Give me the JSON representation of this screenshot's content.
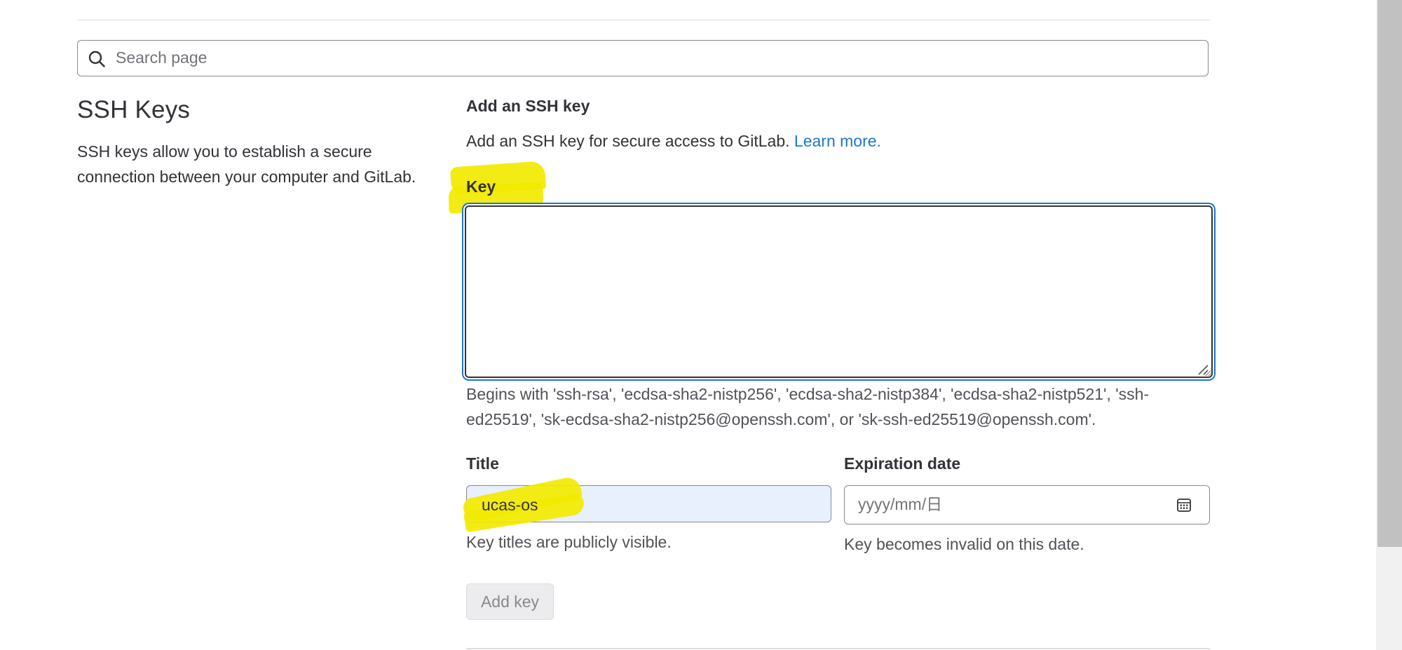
{
  "search": {
    "placeholder": "Search page",
    "value": ""
  },
  "section": {
    "title": "SSH Keys",
    "description": "SSH keys allow you to establish a secure connection between your computer and GitLab."
  },
  "form": {
    "heading": "Add an SSH key",
    "intro_text": "Add an SSH key for secure access to GitLab. ",
    "learn_more_label": "Learn more.",
    "key": {
      "label": "Key",
      "value": "",
      "help": "Begins with 'ssh-rsa', 'ecdsa-sha2-nistp256', 'ecdsa-sha2-nistp384', 'ecdsa-sha2-nistp521', 'ssh-ed25519', 'sk-ecdsa-sha2-nistp256@openssh.com', or 'sk-ssh-ed25519@openssh.com'."
    },
    "title": {
      "label": "Title",
      "value": "ucas-os",
      "help": "Key titles are publicly visible."
    },
    "expiration": {
      "label": "Expiration date",
      "placeholder": "yyyy/mm/日",
      "help": "Key becomes invalid on this date."
    },
    "submit_label": "Add key"
  },
  "icons": {
    "search": "search-icon",
    "calendar": "calendar-icon",
    "resize": "resize-grip-icon"
  },
  "colors": {
    "link": "#1f75cb",
    "focus_ring": "#1f75cb",
    "highlight": "#f2ea00",
    "autofill_background": "#e8f0fe",
    "disabled_button": "#ececef"
  }
}
